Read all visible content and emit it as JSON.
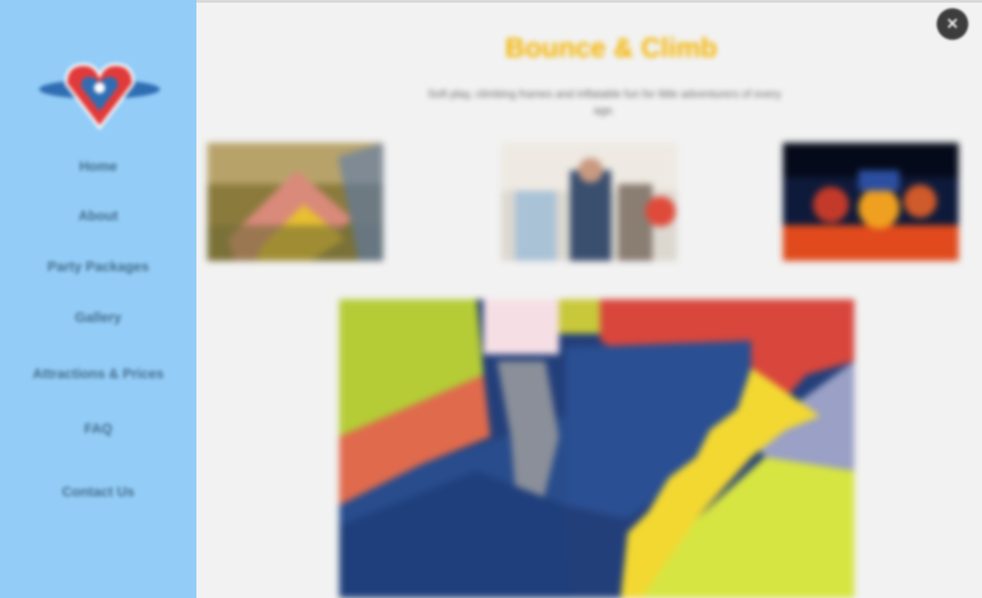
{
  "sidebar": {
    "logo_icon": "heart-badge-logo-icon",
    "nav": [
      {
        "label": "Home"
      },
      {
        "label": "About"
      },
      {
        "label": "Party Packages"
      },
      {
        "label": "Gallery"
      },
      {
        "label": "Attractions & Prices"
      },
      {
        "label": "FAQ"
      },
      {
        "label": "Contact Us"
      }
    ]
  },
  "close": {
    "label": "✕",
    "icon": "close-icon"
  },
  "main": {
    "title": "Bounce & Climb",
    "subtitle": "Soft play, climbing frames and inflatable fun for little adventurers of every age."
  },
  "gallery": {
    "thumbnails": [
      {
        "name": "gallery-thumb-climbing",
        "icon": "photo-icon"
      },
      {
        "name": "gallery-thumb-kids",
        "icon": "photo-icon"
      },
      {
        "name": "gallery-thumb-night",
        "icon": "photo-icon"
      }
    ],
    "featured": {
      "name": "featured-photo-soft-play",
      "icon": "photo-icon"
    }
  },
  "colors": {
    "sidebar_bg": "#93cdf7",
    "page_bg": "#f2f2f2",
    "title_accent": "#f5b400",
    "close_button": "#3d3d3d"
  }
}
